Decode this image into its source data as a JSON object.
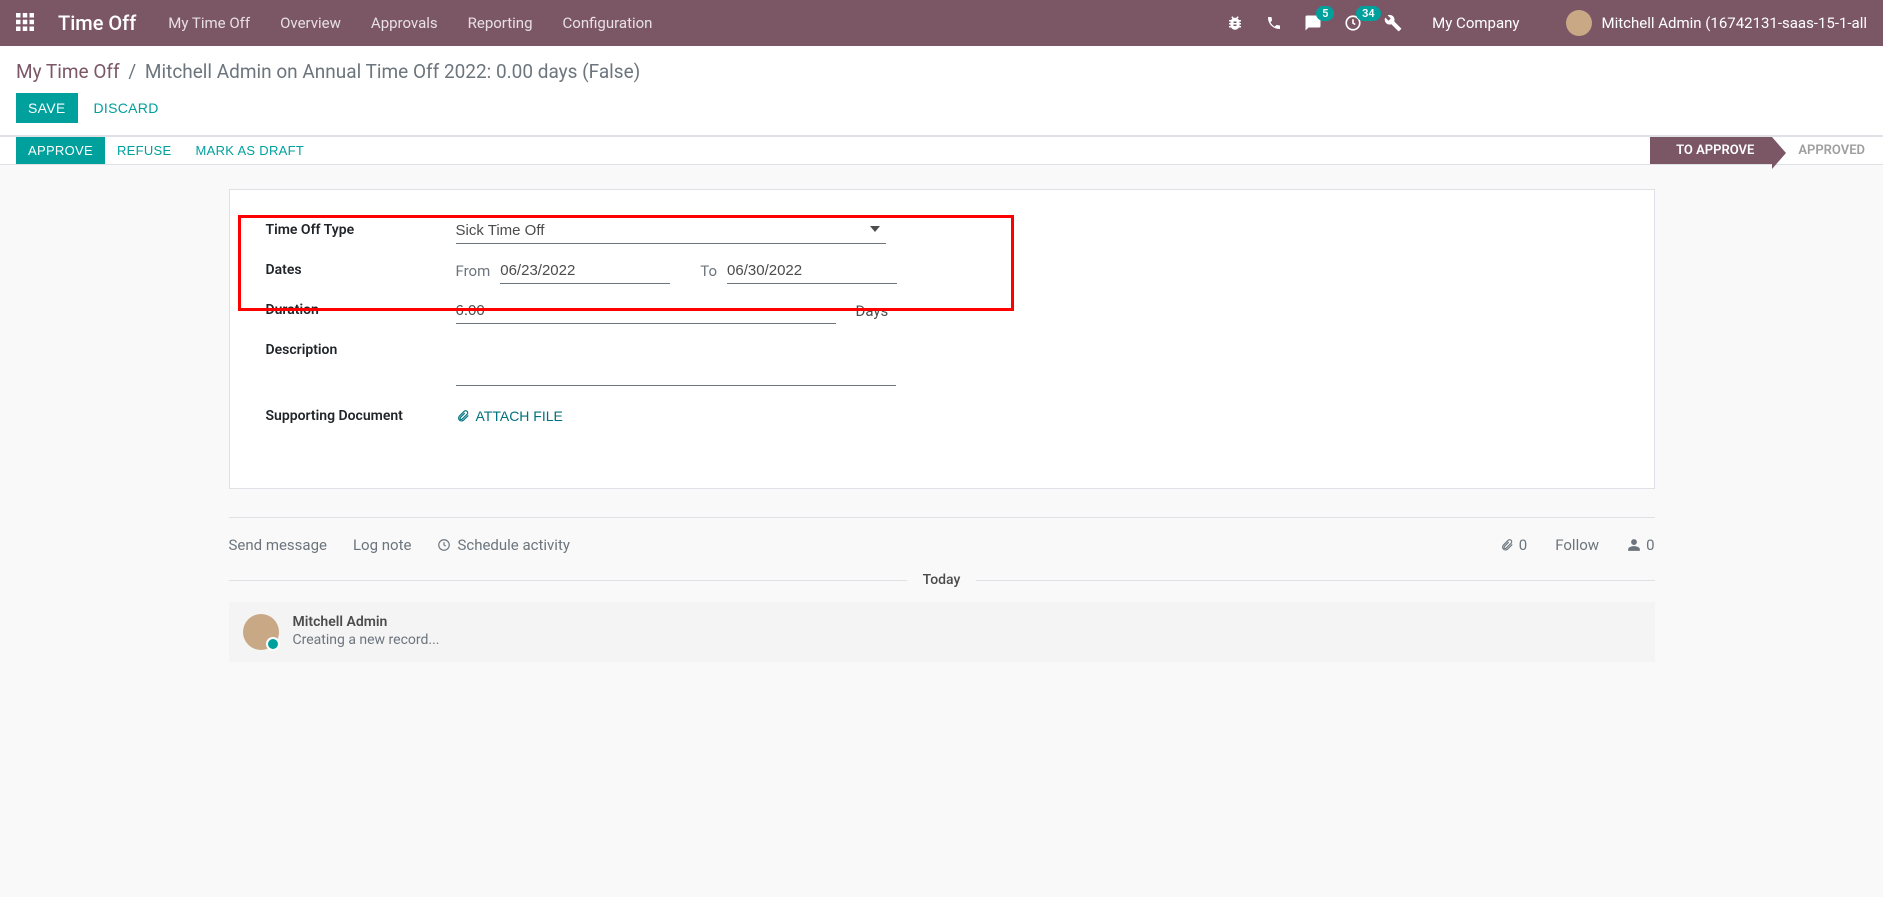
{
  "navbar": {
    "brand": "Time Off",
    "menu": [
      "My Time Off",
      "Overview",
      "Approvals",
      "Reporting",
      "Configuration"
    ],
    "messaging_badge": "5",
    "activity_badge": "34",
    "company": "My Company",
    "user": "Mitchell Admin (16742131-saas-15-1-all"
  },
  "breadcrumb": {
    "root": "My Time Off",
    "current": "Mitchell Admin on Annual Time Off 2022: 0.00 days (False)"
  },
  "buttons": {
    "save": "SAVE",
    "discard": "DISCARD",
    "approve": "APPROVE",
    "refuse": "REFUSE",
    "mark_as_draft": "MARK AS DRAFT"
  },
  "status": {
    "to_approve": "TO APPROVE",
    "approved": "APPROVED"
  },
  "form": {
    "labels": {
      "type": "Time Off Type",
      "dates": "Dates",
      "duration": "Duration",
      "description": "Description",
      "supporting": "Supporting Document"
    },
    "type_value": "Sick Time Off",
    "from_label": "From",
    "from_value": "06/23/2022",
    "to_label": "To",
    "to_value": "06/30/2022",
    "duration_value": "6.00",
    "duration_unit": "Days",
    "description_value": "",
    "attach_label": "ATTACH FILE"
  },
  "chatter": {
    "send": "Send message",
    "log": "Log note",
    "schedule": "Schedule activity",
    "attachments": "0",
    "follow": "Follow",
    "followers": "0",
    "today": "Today",
    "msg_author": "Mitchell Admin",
    "msg_text": "Creating a new record..."
  }
}
